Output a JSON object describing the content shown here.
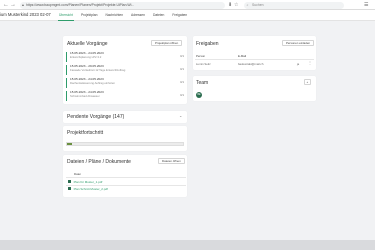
{
  "browser": {
    "url": "https://www.baupmgmt.com/Planen/Planen/Projekt/Projekte.UiPlan.Wi...",
    "search_placeholder": "Suchen",
    "back_icon": "arrow-left-icon",
    "forward_icon": "arrow-right-icon"
  },
  "header": {
    "project_title": "ium Musterkind 2023 02-07",
    "tabs": [
      "Übersicht",
      "Projektplan",
      "Nachrichten",
      "Adressen",
      "Dateien",
      "Freigaben"
    ],
    "active_tab": "Übersicht"
  },
  "aktuelle": {
    "title": "Aktuelle Vorgänge",
    "button": "Projektplan öffnen",
    "tasks": [
      {
        "date": "15.05.2023 - 24.05.2023",
        "desc": "Entwurfsplanung LP2.3.2",
        "count": "0/1"
      },
      {
        "date": "15.05.2023 - 29.05.2023",
        "desc": "Fassade Vorlaufzeit 12 Tage Entwurf/Auftrag",
        "count": "0/1"
      },
      {
        "date": "15.05.2023 - 24.05.2023",
        "desc": "Dachentwässerung Auftrag einholen",
        "count": "0/1"
      },
      {
        "date": "15.05.2023 - 24.05.2023",
        "desc": "Schwimmbad Abwasser",
        "count": "0/1"
      }
    ]
  },
  "pending": {
    "title": "Pendente Vorgänge (147)",
    "chevron_icon": "chevron-down-icon"
  },
  "progress": {
    "title": "Projektfortschritt",
    "percent": 4,
    "color": "#6a9040"
  },
  "files": {
    "title": "Dateien / Pläne / Dokumente",
    "button": "Dateien öffnen",
    "column": "Datei",
    "items": [
      "Plan für Muster_1.pdf",
      "Plan Schnitt Muster_2.pdf"
    ]
  },
  "shares": {
    "title": "Freigaben",
    "button": "Personen einladen",
    "columns": [
      "Person",
      "E-Mail"
    ],
    "rows": [
      {
        "person": "Lumin Seitz",
        "email": "baukontakt@mail.ch",
        "flag": "ja"
      }
    ]
  },
  "team": {
    "title": "Team",
    "avatar_initials": "BE"
  }
}
